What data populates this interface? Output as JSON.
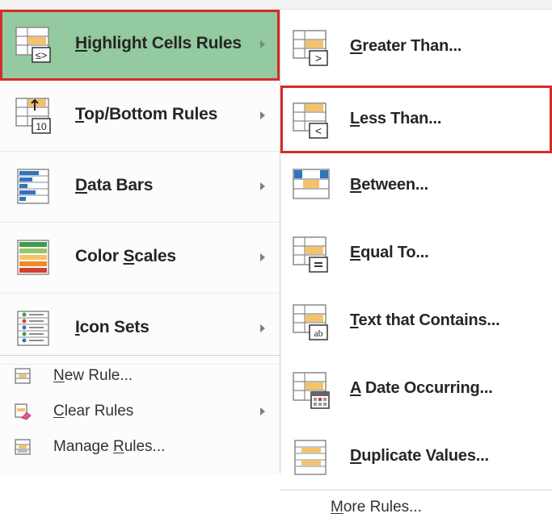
{
  "menu": {
    "items": [
      {
        "label": "Highlight Cells Rules",
        "underline_index": 0,
        "icon": "highlight-cells-rules-icon",
        "has_submenu": true,
        "highlighted": true
      },
      {
        "label": "Top/Bottom Rules",
        "underline_index": 0,
        "icon": "top-bottom-rules-icon",
        "has_submenu": true,
        "highlighted": false
      },
      {
        "label": "Data Bars",
        "underline_index": 0,
        "icon": "data-bars-icon",
        "has_submenu": true,
        "highlighted": false
      },
      {
        "label": "Color Scales",
        "underline_index": 6,
        "icon": "color-scales-icon",
        "has_submenu": true,
        "highlighted": false
      },
      {
        "label": "Icon Sets",
        "underline_index": 0,
        "icon": "icon-sets-icon",
        "has_submenu": true,
        "highlighted": false
      }
    ],
    "small_items": [
      {
        "label": "New Rule...",
        "underline_index": 0,
        "icon": "new-rule-icon",
        "has_submenu": false
      },
      {
        "label": "Clear Rules",
        "underline_index": 0,
        "icon": "clear-rules-icon",
        "has_submenu": true
      },
      {
        "label": "Manage Rules...",
        "underline_index": 7,
        "icon": "manage-rules-icon",
        "has_submenu": false
      }
    ]
  },
  "submenu": {
    "items": [
      {
        "label": "Greater Than...",
        "underline_index": 0,
        "icon": "greater-than-icon",
        "highlighted": false
      },
      {
        "label": "Less Than...",
        "underline_index": 0,
        "icon": "less-than-icon",
        "highlighted": true
      },
      {
        "label": "Between...",
        "underline_index": 0,
        "icon": "between-icon",
        "highlighted": false
      },
      {
        "label": "Equal To...",
        "underline_index": 0,
        "icon": "equal-to-icon",
        "highlighted": false
      },
      {
        "label": "Text that Contains...",
        "underline_index": 0,
        "icon": "text-contains-icon",
        "highlighted": false
      },
      {
        "label": "A Date Occurring...",
        "underline_index": 0,
        "icon": "date-occurring-icon",
        "highlighted": false
      },
      {
        "label": "Duplicate Values...",
        "underline_index": 0,
        "icon": "duplicate-values-icon",
        "highlighted": false
      }
    ],
    "more_rules": {
      "label": "More Rules...",
      "underline_index": 0
    }
  },
  "colors": {
    "highlight_fill": "#93ca9f",
    "highlight_border": "#d62b2b",
    "cell_orange": "#f5c26b",
    "bar_blue": "#2e74c0",
    "scale_green": "#3f9b4a",
    "scale_orange": "#f08a24",
    "scale_red": "#d43f2f"
  }
}
